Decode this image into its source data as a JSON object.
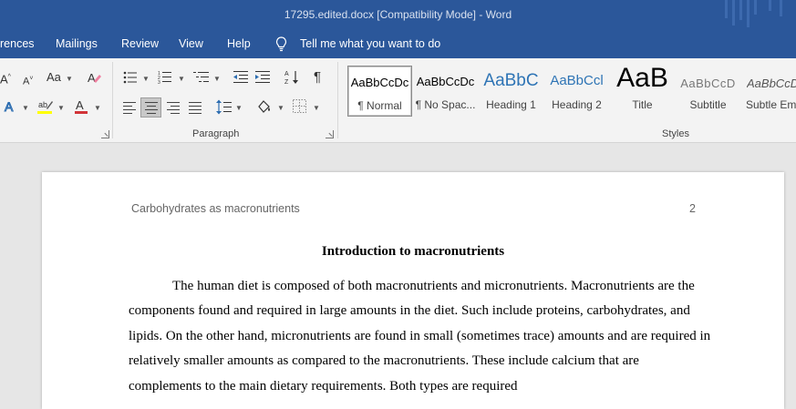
{
  "window": {
    "title": "17295.edited.docx [Compatibility Mode]  -  Word"
  },
  "ribbon_tabs": [
    {
      "label": "rences"
    },
    {
      "label": "Mailings"
    },
    {
      "label": "Review"
    },
    {
      "label": "View"
    },
    {
      "label": "Help"
    }
  ],
  "tell_me": {
    "label": "Tell me what you want to do"
  },
  "font_group": {
    "change_case": "Aa",
    "highlight_color": "#ffff00",
    "font_color": "#d13438"
  },
  "paragraph_group": {
    "label": "Paragraph"
  },
  "styles_group": {
    "label": "Styles",
    "items": [
      {
        "sample": "AaBbCcDc",
        "name": "¶ Normal"
      },
      {
        "sample": "AaBbCcDc",
        "name": "¶ No Spac..."
      },
      {
        "sample": "AaBbC",
        "name": "Heading 1"
      },
      {
        "sample": "AaBbCcl",
        "name": "Heading 2"
      },
      {
        "sample": "AaB",
        "name": "Title"
      },
      {
        "sample": "AaBbCcD",
        "name": "Subtitle"
      },
      {
        "sample": "AaBbCcD",
        "name": "Subtle Em..."
      }
    ]
  },
  "document": {
    "running_header": "Carbohydrates as macronutrients",
    "page_number": "2",
    "heading": "Introduction to macronutrients",
    "paragraph": "The human diet is composed of both macronutrients and micronutrients. Macronutrients are the components found and required in large amounts in the diet. Such include proteins, carbohydrates, and lipids. On the other hand, micronutrients are found in small (sometimes trace) amounts and are required in relatively smaller amounts as compared to the macronutrients. These include calcium that are complements to the main dietary requirements. Both types are required"
  }
}
